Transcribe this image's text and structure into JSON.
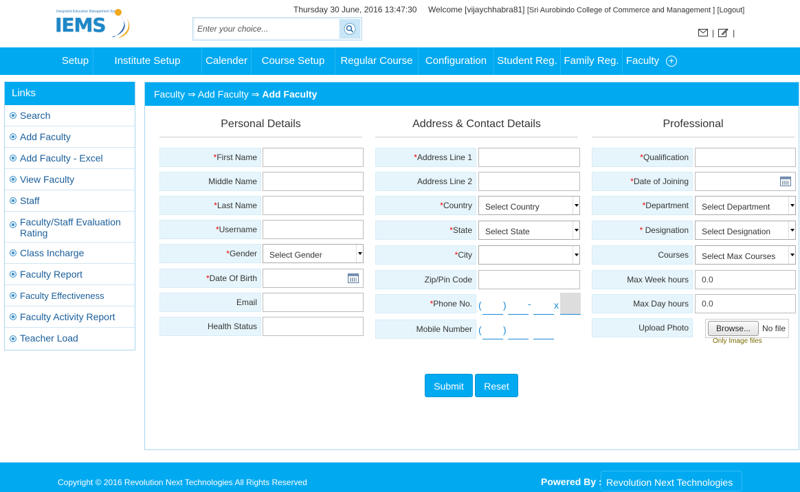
{
  "header": {
    "logo_text": "IEMS",
    "logo_subtitle": "Integrated Education Management System",
    "datetime": "Thursday 30 June, 2016 13:47:30",
    "welcome": "Welcome [vijaychhabra81]",
    "college": "[Sri Aurobindo College of Commerce and Management ]",
    "logout": "[Logout]",
    "search_placeholder": "Enter your choice..."
  },
  "nav": {
    "items": [
      "Setup",
      "Institute Setup",
      "Calender",
      "Course Setup",
      "Regular Course",
      "Configuration",
      "Student Reg.",
      "Family Reg.",
      "Faculty"
    ]
  },
  "sidebar": {
    "title": "Links",
    "items": [
      {
        "label": "Search"
      },
      {
        "label": "Add Faculty"
      },
      {
        "label": "Add Faculty - Excel"
      },
      {
        "label": "View Faculty"
      },
      {
        "label": "Staff"
      },
      {
        "label": "Faculty/Staff Evaluation Rating"
      },
      {
        "label": "Class Incharge"
      },
      {
        "label": "Faculty Report"
      },
      {
        "label": "Faculty Effectiveness"
      },
      {
        "label": "Faculty Activity Report"
      },
      {
        "label": "Teacher Load"
      }
    ]
  },
  "breadcrumb": {
    "part1": "Faculty",
    "sep": "⇒",
    "part2": "Add Faculty",
    "current": "Add Faculty"
  },
  "personal": {
    "title": "Personal Details",
    "first_name": "First Name",
    "middle_name": "Middle Name",
    "last_name": "Last Name",
    "username": "Username",
    "gender": "Gender",
    "gender_value": "Select Gender",
    "dob": "Date Of Birth",
    "email": "Email",
    "health": "Health Status"
  },
  "address": {
    "title": "Address & Contact Details",
    "line1": "Address Line 1",
    "line2": "Address Line 2",
    "country": "Country",
    "country_value": "Select Country",
    "state": "State",
    "state_value": "Select State",
    "city": "City",
    "zip": "Zip/Pin Code",
    "phone": "Phone No.",
    "mobile": "Mobile Number",
    "phone_open": "(",
    "phone_close": ")",
    "phone_dash": "-",
    "phone_ext": "x"
  },
  "professional": {
    "title": "Professional",
    "qualification": "Qualification",
    "doj": "Date of Joining",
    "department": "Department",
    "department_value": "Select Department",
    "designation": "Designation",
    "designation_value": "Select Designation",
    "courses": "Courses",
    "courses_value": "Select Max Courses",
    "max_week": "Max Week hours",
    "max_week_value": "0.0",
    "max_day": "Max Day hours",
    "max_day_value": "0.0",
    "upload": "Upload Photo",
    "browse": "Browse...",
    "no_file": "No file",
    "hint": "Only Image files"
  },
  "actions": {
    "submit": "Submit",
    "reset": "Reset"
  },
  "footer": {
    "copyright": "Copyright © 2016 Revolution Next Technologies All Rights Reserved",
    "powered_label": "Powered By :",
    "powered_name": "Revolution Next Technologies"
  },
  "colors": {
    "primary": "#01a9f1",
    "label_bg": "#e6f5fc",
    "required": "#ee0000",
    "link": "#1a5e9a"
  }
}
